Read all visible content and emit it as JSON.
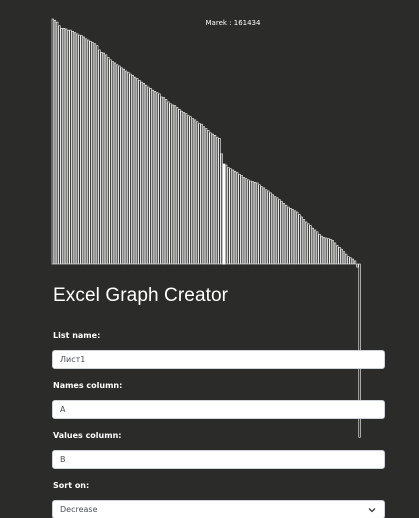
{
  "chart_data": {
    "type": "bar",
    "title": "",
    "xlabel": "",
    "ylabel": "",
    "grid": false,
    "legend": "none",
    "sort_order": "descending",
    "hover_label": "Marek : 161434",
    "highlighted_category": "Marek",
    "highlighted_value": 161434,
    "ylim": [
      0,
      396000
    ],
    "values": [
      396000,
      394000,
      391000,
      385000,
      381000,
      381000,
      380000,
      378000,
      378000,
      376000,
      374000,
      372000,
      370000,
      369000,
      367000,
      364000,
      362000,
      360000,
      358000,
      356000,
      353000,
      346000,
      342000,
      341000,
      338000,
      334000,
      330000,
      327000,
      325000,
      322000,
      320000,
      317000,
      315000,
      312000,
      310000,
      307000,
      305000,
      302000,
      300000,
      297000,
      294000,
      292000,
      289000,
      286000,
      284000,
      281000,
      279000,
      277000,
      275000,
      270000,
      269000,
      266000,
      262000,
      259000,
      257000,
      256000,
      253000,
      250000,
      247000,
      245000,
      243000,
      240000,
      238000,
      235000,
      233000,
      230000,
      227000,
      226000,
      222000,
      219000,
      216000,
      212000,
      210000,
      208000,
      205000,
      203000,
      178000,
      161434,
      160000,
      156000,
      154000,
      152000,
      150000,
      148000,
      145000,
      143000,
      140000,
      138000,
      136000,
      134000,
      133000,
      132000,
      131000,
      128000,
      125000,
      123000,
      120000,
      118000,
      115000,
      112000,
      109000,
      107000,
      104000,
      101000,
      98000,
      95000,
      92000,
      90000,
      88000,
      86000,
      84000,
      80000,
      76000,
      72000,
      68000,
      65000,
      62000,
      58000,
      55000,
      52000,
      48000,
      45000,
      43000,
      42000,
      41000,
      40000,
      38000,
      34000,
      30000,
      27000,
      24000,
      20000,
      16000,
      12000,
      10000,
      8000,
      5000,
      -5000,
      -280000
    ]
  },
  "app": {
    "title": "Excel Graph Creator"
  },
  "form": {
    "list_name": {
      "label": "List name:",
      "value": "Лист1"
    },
    "names_column": {
      "label": "Names column:",
      "value": "A"
    },
    "values_column": {
      "label": "Values column:",
      "value": "B"
    },
    "sort_on": {
      "label": "Sort on:",
      "value": "Decrease",
      "icon": "chevron-down-icon"
    }
  },
  "colors": {
    "background": "#2b2c2a",
    "bar_fill": "#2b2c2a",
    "bar_stroke": "#ffffff",
    "highlight_fill": "#ffffff"
  }
}
